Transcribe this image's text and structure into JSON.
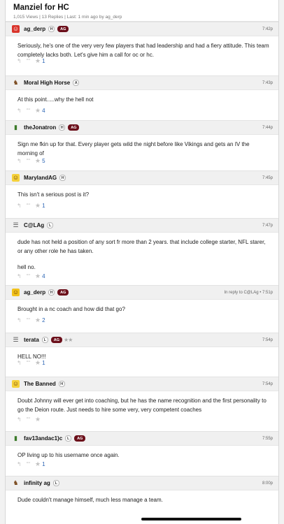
{
  "thread": {
    "title": "Manziel for HC",
    "meta": "1,015 Views | 13 Replies | Last: 1 min ago by ag_derp"
  },
  "icons": {
    "reply": "reply-arrow-icon",
    "quote": "quote-icon",
    "star": "star-icon"
  },
  "colors": {
    "aggie_badge": "#6b0f1a",
    "like_count": "#2a64b4",
    "header_bg": "#f0f0f0"
  },
  "posts": [
    {
      "username": "ag_derp",
      "avatar": "red-face-avatar",
      "badges": [
        "H",
        "AG"
      ],
      "time": "7:42p",
      "body": [
        "Seriously, he's one of the very very few players that had leadership and had a fiery attitude. This team completely lacks both. Let's give him a call for oc or hc."
      ],
      "likes": "1"
    },
    {
      "username": "Moral High Horse",
      "avatar": "horse-avatar",
      "badges": [
        "A"
      ],
      "time": "7:43p",
      "body": [
        "At this point.....why the hell not"
      ],
      "likes": "4"
    },
    {
      "username": "theJonatron",
      "avatar": "bottle-avatar",
      "badges": [
        "H",
        "AG"
      ],
      "time": "7:44p",
      "body": [
        "Sign me fkin up for that. Every player gets wild the night before like Vikings and gets an IV the morning of"
      ],
      "likes": "5"
    },
    {
      "username": "MarylandAG",
      "avatar": "smiley-avatar",
      "badges": [
        "H"
      ],
      "time": "7:45p",
      "body": [
        "This isn't a serious post is it?"
      ],
      "likes": "1"
    },
    {
      "username": "C@LAg",
      "avatar": "document-avatar",
      "badges": [
        "L"
      ],
      "time": "7:47p",
      "body": [
        "dude has not held a position of any sort fr more than 2 years. that include college starter, NFL starer, or any other role he has taken.",
        "hell no."
      ],
      "likes": "4"
    },
    {
      "username": "ag_derp",
      "avatar": "grin-face-avatar",
      "badges": [
        "H",
        "AG"
      ],
      "time": "In reply to C@LAg • 7:51p",
      "body": [
        "Brought in a nc coach and how did that go?"
      ],
      "likes": "2"
    },
    {
      "username": "terata",
      "avatar": "document-avatar",
      "badges": [
        "L",
        "AG"
      ],
      "stars": "★★",
      "time": "7:54p",
      "body": [
        "HELL NO!!!"
      ],
      "likes": "1"
    },
    {
      "username": "The Banned",
      "avatar": "smiley-avatar",
      "badges": [
        "H"
      ],
      "time": "7:54p",
      "body": [
        "Doubt Johnny will ever get into coaching, but he has the name recognition and the first personality to go the Deion route. Just needs to hire some very, very competent coaches"
      ],
      "likes": ""
    },
    {
      "username": "fav13andac1)c",
      "avatar": "bottle-avatar",
      "badges": [
        "L",
        "AG"
      ],
      "time": "7:55p",
      "body": [
        "OP living up to his username once again."
      ],
      "likes": "1"
    },
    {
      "username": "infinity ag",
      "avatar": "horse-avatar",
      "badges": [
        "L"
      ],
      "time": "8:00p",
      "body": [
        "Dude couldn't manage himself, much less manage a team."
      ],
      "likes": ""
    }
  ]
}
